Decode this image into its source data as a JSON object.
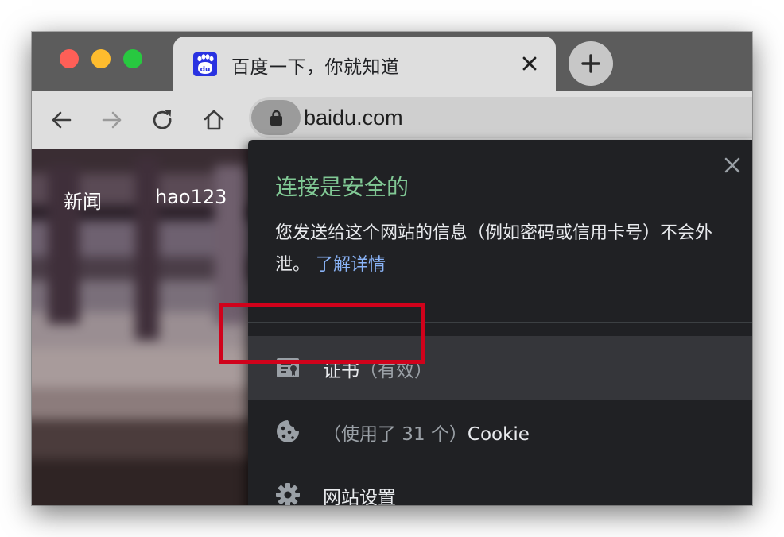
{
  "tab": {
    "title": "百度一下，你就知道",
    "favicon_text": "du"
  },
  "toolbar": {
    "url": "baidu.com"
  },
  "page": {
    "links": [
      "新闻",
      "hao123"
    ]
  },
  "popup": {
    "title": "连接是安全的",
    "description": "您发送给这个网站的信息（例如密码或信用卡号）不会外泄。",
    "learn_more": "了解详情",
    "rows": [
      {
        "label": "证书",
        "status": "（有效）",
        "icon": "certificate-icon"
      },
      {
        "prefix": "（使用了 31 个）",
        "label": "Cookie",
        "icon": "cookie-icon"
      },
      {
        "label": "网站设置",
        "icon": "gear-icon"
      }
    ]
  },
  "colors": {
    "secure_green": "#81c995",
    "link_blue": "#8ab4f8",
    "highlight_red": "#d0021b",
    "popup_bg": "#202124"
  }
}
